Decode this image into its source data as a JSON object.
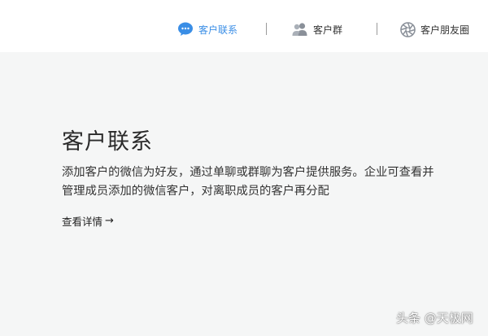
{
  "tabs": [
    {
      "label": "客户联系",
      "icon": "chat-bubble-icon",
      "active": true
    },
    {
      "label": "客户群",
      "icon": "group-users-icon",
      "active": false
    },
    {
      "label": "客户朋友圈",
      "icon": "aperture-icon",
      "active": false
    }
  ],
  "content": {
    "title": "客户联系",
    "description": "添加客户的微信为好友，通过单聊或群聊为客户提供服务。企业可查看并管理成员添加的微信客户，对离职成员的客户再分配",
    "link_label": "查看详情",
    "link_arrow": "→"
  },
  "watermark": "头条 @天极网",
  "colors": {
    "accent": "#3a8ee6",
    "background": "#f5f6f6",
    "header_background": "#ffffff"
  }
}
